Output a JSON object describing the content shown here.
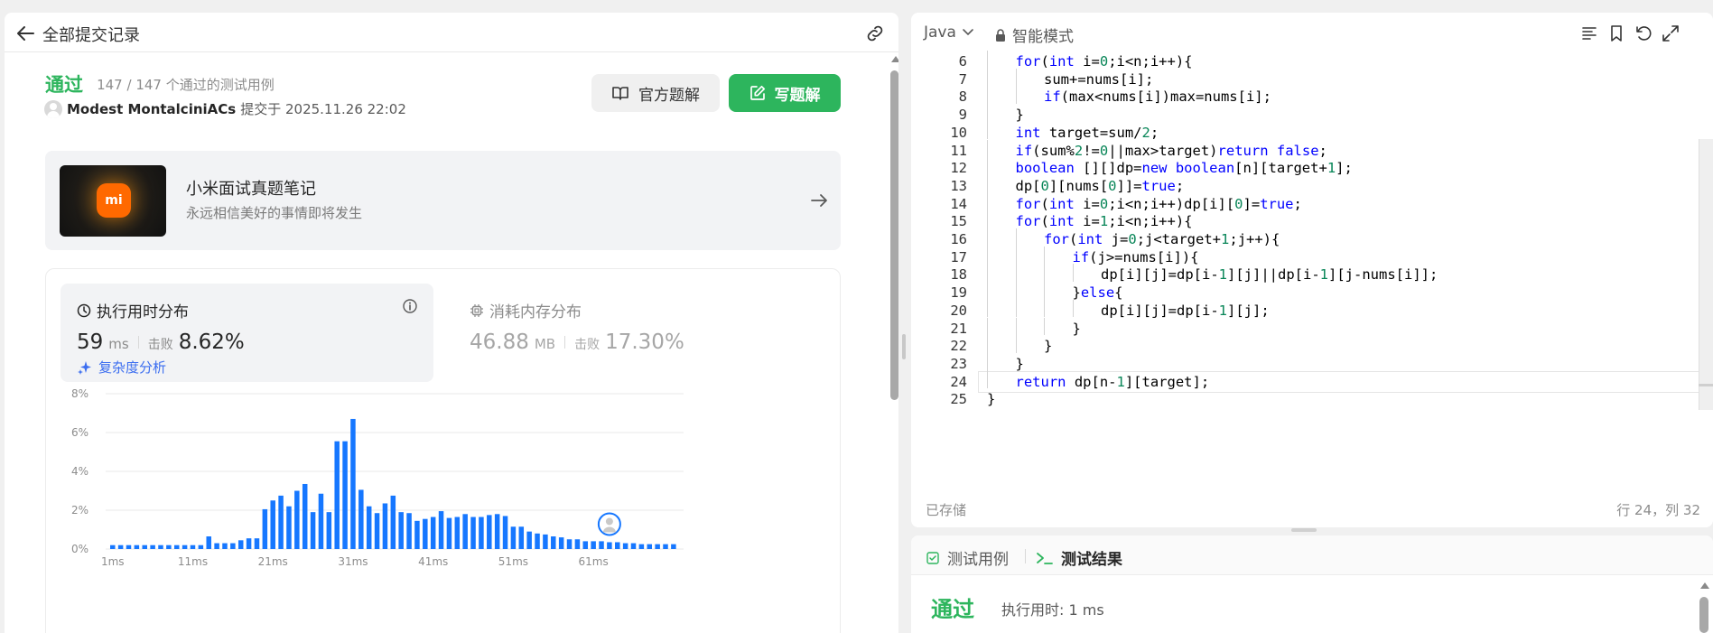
{
  "submission": {
    "header_title": "全部提交记录",
    "status": "通过",
    "testcases": "147 / 147 个通过的测试用例",
    "submitter": "Modest MontalciniACs",
    "submitted_at": "提交于 2025.11.26 22:02",
    "official_solution_label": "官方题解",
    "write_solution_label": "写题解"
  },
  "promo": {
    "logo_text": "mi",
    "title": "小米面试真题笔记",
    "subtitle": "永远相信美好的事情即将发生"
  },
  "runtime": {
    "title": "执行用时分布",
    "value": "59",
    "unit": "ms",
    "beat_label": "击败",
    "beat_pct": "8.62%",
    "complexity_link": "复杂度分析"
  },
  "memory": {
    "title": "消耗内存分布",
    "value": "46.88",
    "unit": "MB",
    "beat_label": "击败",
    "beat_pct": "17.30%"
  },
  "chart_data": {
    "type": "bar",
    "title": "",
    "xlabel": "",
    "ylabel": "",
    "x_tick_labels": [
      "1ms",
      "11ms",
      "21ms",
      "31ms",
      "41ms",
      "51ms",
      "61ms"
    ],
    "y_tick_labels": [
      "0%",
      "2%",
      "4%",
      "6%",
      "8%"
    ],
    "ylim": [
      0,
      8
    ],
    "grid": true,
    "bar_color": "#1677ff",
    "values": [
      0.2,
      0.2,
      0.2,
      0.2,
      0.2,
      0.2,
      0.2,
      0.2,
      0.2,
      0.2,
      0.2,
      0.2,
      0.65,
      0.3,
      0.3,
      0.3,
      0.45,
      0.55,
      0.55,
      2.05,
      2.5,
      2.75,
      2.2,
      3.0,
      3.35,
      1.9,
      2.85,
      1.9,
      5.55,
      5.55,
      6.7,
      3.05,
      2.2,
      1.85,
      2.35,
      2.75,
      1.9,
      1.85,
      1.45,
      1.55,
      1.65,
      1.95,
      1.6,
      1.65,
      1.8,
      1.65,
      1.65,
      1.75,
      1.8,
      1.7,
      1.15,
      1.15,
      0.9,
      0.8,
      0.75,
      0.65,
      0.6,
      0.5,
      0.5,
      0.4,
      0.4,
      0.4,
      0.35,
      0.35,
      0.3,
      0.3,
      0.25,
      0.25,
      0.25,
      0.25,
      0.25
    ],
    "user_marker_index": 62
  },
  "editor": {
    "language": "Java",
    "mode": "智能模式",
    "saved_label": "已存储",
    "cursor_position": "行 24，列 32",
    "current_line": 24,
    "lines": [
      {
        "n": "6",
        "indent": 2,
        "code": "for(int i=0;i<n;i++){"
      },
      {
        "n": "7",
        "indent": 3,
        "code": "sum+=nums[i];"
      },
      {
        "n": "8",
        "indent": 3,
        "code": "if(max<nums[i])max=nums[i];"
      },
      {
        "n": "9",
        "indent": 2,
        "code": "}"
      },
      {
        "n": "10",
        "indent": 2,
        "code": "int target=sum/2;"
      },
      {
        "n": "11",
        "indent": 2,
        "code": "if(sum%2!=0||max>target)return false;"
      },
      {
        "n": "12",
        "indent": 2,
        "code": "boolean [][]dp=new boolean[n][target+1];"
      },
      {
        "n": "13",
        "indent": 2,
        "code": "dp[0][nums[0]]=true;"
      },
      {
        "n": "14",
        "indent": 2,
        "code": "for(int i=0;i<n;i++)dp[i][0]=true;"
      },
      {
        "n": "15",
        "indent": 2,
        "code": "for(int i=1;i<n;i++){"
      },
      {
        "n": "16",
        "indent": 3,
        "code": "for(int j=0;j<target+1;j++){"
      },
      {
        "n": "17",
        "indent": 4,
        "code": "if(j>=nums[i]){"
      },
      {
        "n": "18",
        "indent": 5,
        "code": "dp[i][j]=dp[i-1][j]||dp[i-1][j-nums[i]];"
      },
      {
        "n": "19",
        "indent": 4,
        "code": "}else{"
      },
      {
        "n": "20",
        "indent": 5,
        "code": "dp[i][j]=dp[i-1][j];"
      },
      {
        "n": "21",
        "indent": 4,
        "code": "}"
      },
      {
        "n": "22",
        "indent": 3,
        "code": "}"
      },
      {
        "n": "23",
        "indent": 2,
        "code": "}"
      },
      {
        "n": "24",
        "indent": 2,
        "code": "return dp[n-1][target];"
      },
      {
        "n": "25",
        "indent": 1,
        "code": "}"
      }
    ]
  },
  "result_panel": {
    "tab_testcase": "测试用例",
    "tab_result": "测试结果",
    "status": "通过",
    "runtime": "执行用时: 1 ms"
  },
  "colors": {
    "accent_green": "#2db55d",
    "bar_blue": "#1677ff",
    "link_blue": "#3c6ef0"
  }
}
